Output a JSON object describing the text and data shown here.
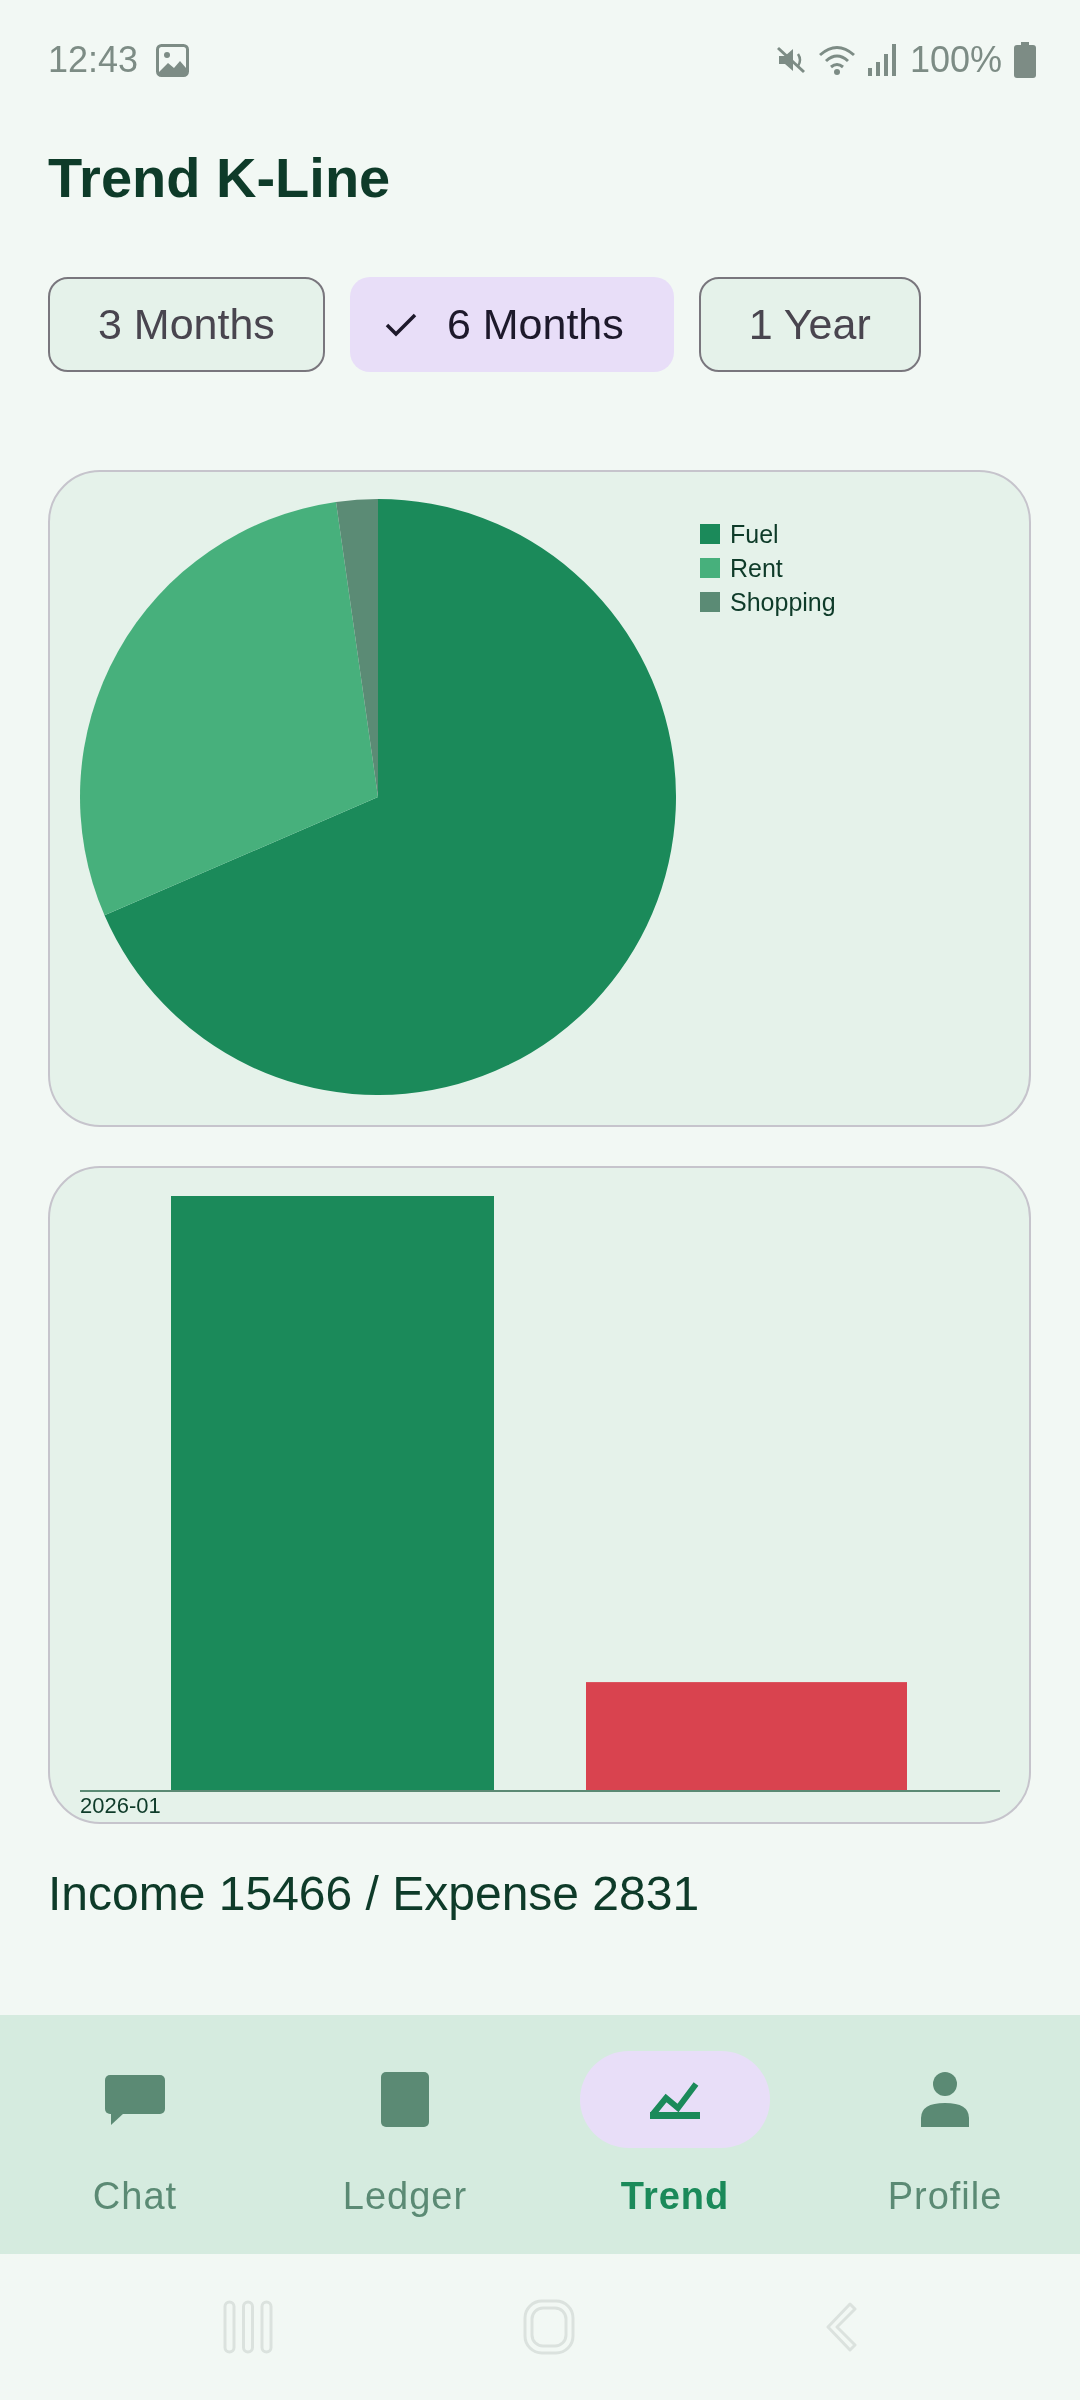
{
  "status_bar": {
    "time": "12:43",
    "battery": "100%"
  },
  "title": "Trend K-Line",
  "filters": [
    {
      "label": "3 Months",
      "selected": false
    },
    {
      "label": "6 Months",
      "selected": true
    },
    {
      "label": "1 Year",
      "selected": false
    }
  ],
  "pie_chart": {
    "legend": [
      {
        "label": "Fuel",
        "color": "#1b8a5a"
      },
      {
        "label": "Rent",
        "color": "#47b07c"
      },
      {
        "label": "Shopping",
        "color": "#5b8b75"
      }
    ]
  },
  "bar_chart": {
    "x_axis_label": "2026-01"
  },
  "summary": "Income 15466 / Expense 2831",
  "bottom_nav": [
    {
      "label": "Chat",
      "selected": false
    },
    {
      "label": "Ledger",
      "selected": false
    },
    {
      "label": "Trend",
      "selected": true
    },
    {
      "label": "Profile",
      "selected": false
    }
  ]
}
